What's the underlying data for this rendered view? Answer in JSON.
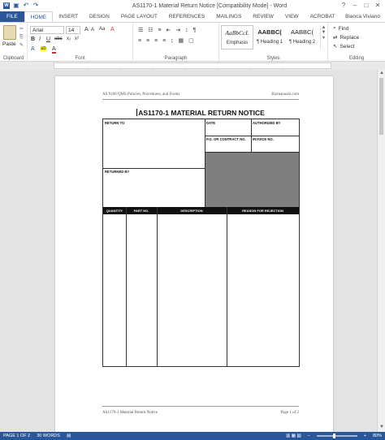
{
  "window": {
    "title": "AS1170-1 Material Return Notice [Compatibility Mode] - Word",
    "help": "?",
    "minimize": "–",
    "maximize": "□",
    "close": "✕"
  },
  "quick_access": {
    "save_icon": "save-icon",
    "undo_icon": "undo-icon",
    "redo_icon": "redo-icon"
  },
  "tabs": [
    "FILE",
    "HOME",
    "INSERT",
    "DESIGN",
    "PAGE LAYOUT",
    "REFERENCES",
    "MAILINGS",
    "REVIEW",
    "VIEW",
    "ACROBAT"
  ],
  "user": "Bianca Viviano",
  "ribbon": {
    "clipboard": {
      "label": "Clipboard",
      "paste": "Paste"
    },
    "font": {
      "label": "Font",
      "name": "Arial",
      "size": "14",
      "bold": "B",
      "italic": "I",
      "underline": "U",
      "strike": "abc",
      "sub": "x₂",
      "sup": "x²",
      "grow": "A",
      "shrink": "A",
      "case": "Aa",
      "clear": "A",
      "highlight": "ab",
      "color": "A"
    },
    "paragraph": {
      "label": "Paragraph"
    },
    "styles": {
      "label": "Styles",
      "items": [
        {
          "sample": "AaBbCcL",
          "name": "Emphasis"
        },
        {
          "sample": "AABBC(",
          "name": "¶ Heading 1"
        },
        {
          "sample": "AABBC(",
          "name": "¶ Heading 2"
        }
      ]
    },
    "editing": {
      "label": "Editing",
      "find": "Find",
      "replace": "Replace",
      "select": "Select"
    }
  },
  "document": {
    "header_left": "AS 9100 QMS Policies, Procedures, and Forms",
    "header_right": "Bizmanualz.com",
    "title": "AS1170-1 MATERIAL RETURN NOTICE",
    "form": {
      "return_to": "RETURN TO",
      "date": "DATE",
      "authorized_by": "AUTHORIZED BY",
      "po_contract": "P.O. OR CONTRACT NO.",
      "invoice": "INVOICE NO.",
      "returned_by": "RETURNED BY",
      "columns": [
        "QUANTITY",
        "PART NO.",
        "DESCRIPTION",
        "REASON FOR REJECTION"
      ]
    },
    "footer_left": "AS1170-1 Material Return Notice",
    "footer_right": "Page 1 of 2"
  },
  "status": {
    "page": "PAGE 1 OF 2",
    "words": "30 WORDS",
    "zoom": "80%"
  }
}
